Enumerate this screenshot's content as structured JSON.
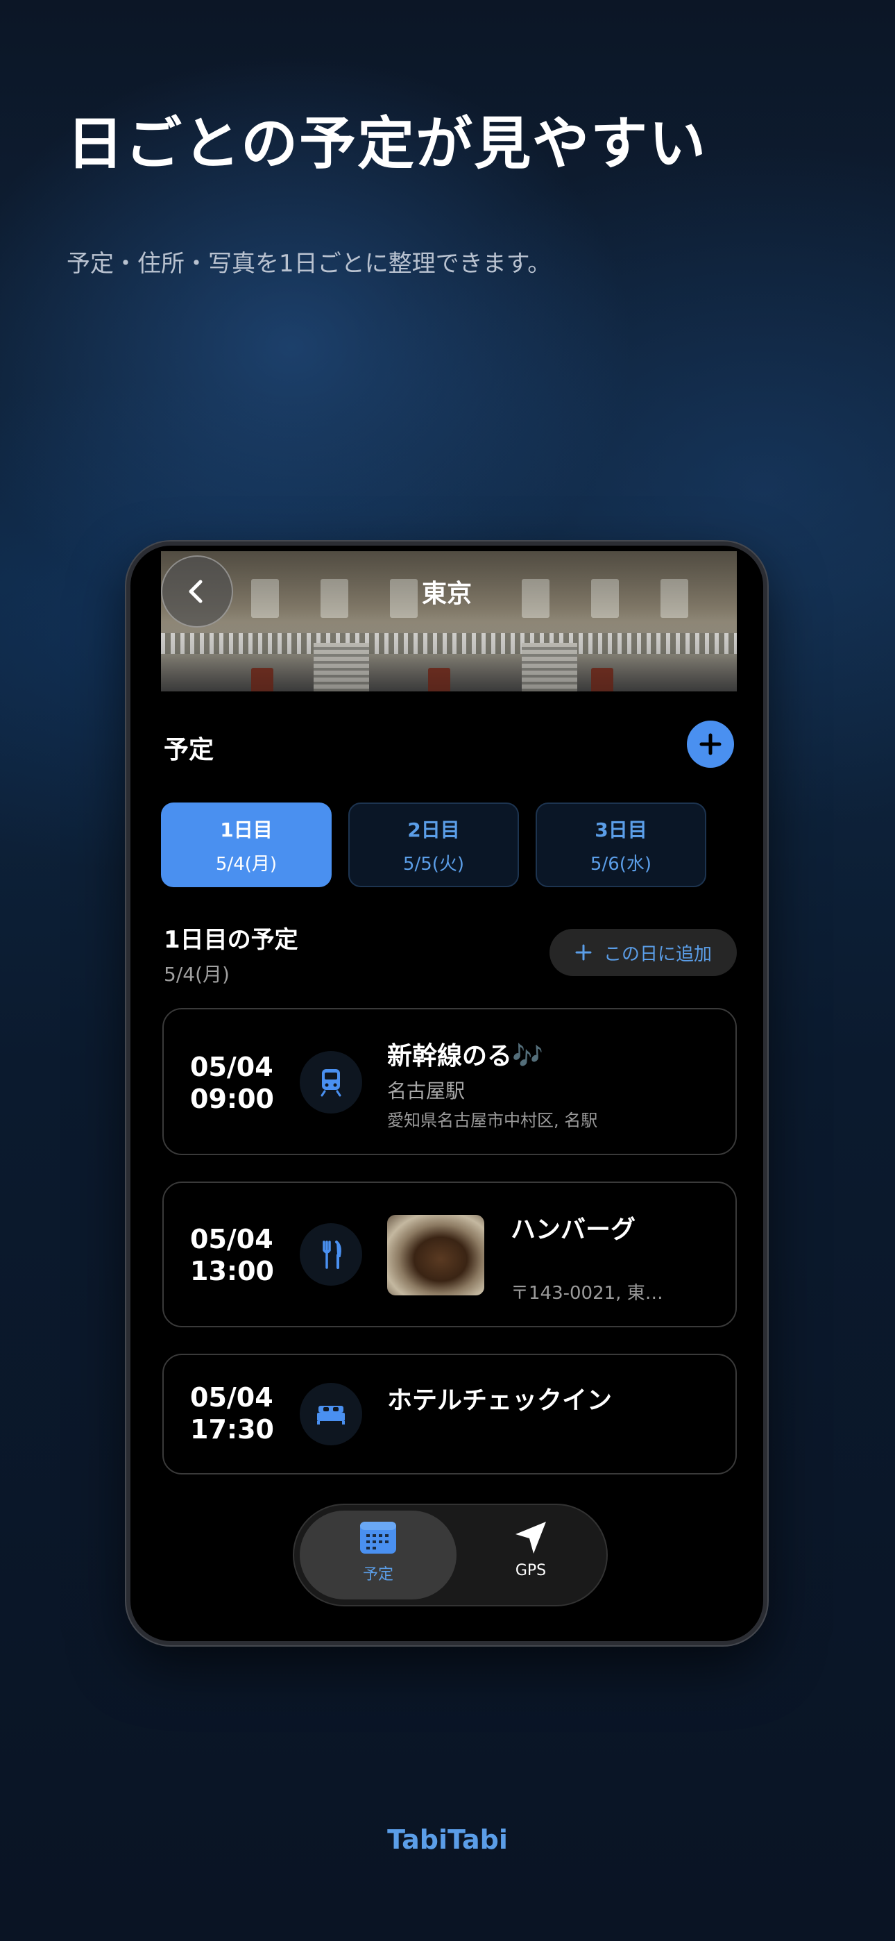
{
  "marketing": {
    "headline": "日ごとの予定が見やすい",
    "subline": "予定・住所・写真を1日ごとに整理できます。",
    "brand": "TabiTabi"
  },
  "header": {
    "title": "東京"
  },
  "schedule": {
    "section_title": "予定",
    "days": [
      {
        "label": "1日目",
        "date": "5/4(月)",
        "active": true
      },
      {
        "label": "2日目",
        "date": "5/5(火)",
        "active": false
      },
      {
        "label": "3日目",
        "date": "5/6(水)",
        "active": false
      }
    ],
    "day_heading": "1日目の予定",
    "day_date": "5/4(月)",
    "add_to_day": "この日に追加",
    "items": [
      {
        "date": "05/04",
        "time": "09:00",
        "icon": "train-icon",
        "title": "新幹線のる🎶",
        "place": "名古屋駅",
        "address": "愛知県名古屋市中村区, 名駅"
      },
      {
        "date": "05/04",
        "time": "13:00",
        "icon": "fork-knife-icon",
        "title": "ハンバーグ",
        "address": "〒143-0021, 東…"
      },
      {
        "date": "05/04",
        "time": "17:30",
        "icon": "bed-icon",
        "title": "ホテルチェックイン"
      }
    ]
  },
  "tabbar": {
    "items": [
      {
        "label": "予定",
        "icon": "calendar-icon",
        "active": true
      },
      {
        "label": "GPS",
        "icon": "location-arrow-icon",
        "active": false
      }
    ]
  },
  "colors": {
    "accent": "#4a90f0",
    "accent_text": "#5b9ee8",
    "card_border": "#3a3a3a"
  }
}
